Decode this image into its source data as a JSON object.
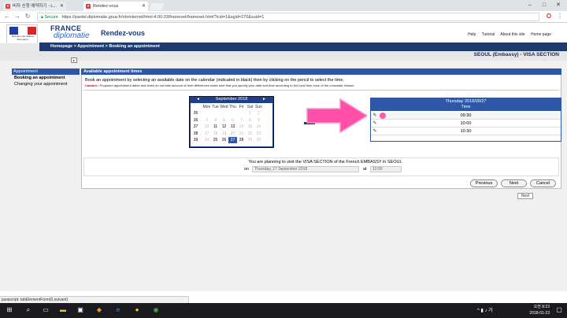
{
  "browser": {
    "tabs": [
      {
        "label": "비자 신청 예약하기 - L..."
      },
      {
        "label": "Rendez-vous"
      }
    ],
    "secure_label": "Secure",
    "url": "https://pastel.diplomatie.gouv.fr/rdvinternet/html-4.00.03/frameset/frameset.html?lcid=1&sgid=270&suid=1",
    "window_controls": [
      "–",
      "□",
      "✕"
    ]
  },
  "site": {
    "logo_text": "Ministère des Affaires Étrangères",
    "brand_line1": "FRANCE",
    "brand_line2": "diplomatie",
    "app_title": "Rendez-vous",
    "top_links": [
      "Help",
      "Tutorial",
      "About this site",
      "Home page"
    ],
    "breadcrumb": "Homepage > Appointment > Booking an appointment",
    "section_title": "SEOUL (Embassy) - VISA SECTION",
    "homepage_small": "Homepage"
  },
  "left_nav": {
    "header": "Appointment",
    "items": [
      {
        "label": "Booking an appointment"
      },
      {
        "label": "Changing your appointment"
      }
    ]
  },
  "panel": {
    "title": "Available appointment times",
    "instruction": "Book an appointment by selecting an available date on the calendar (indicated in black) then by clicking on the pencil to select the time.",
    "caution_label": "Caution :",
    "caution_text": "Proposed appointment dates and times do not take account of time differences make sure that you specify your date and time according to the local time zone of the consulate chosen."
  },
  "calendar": {
    "title": "September 2018",
    "prev": "◄",
    "next": "►",
    "day_headers": [
      "Mon",
      "Tue",
      "Wed",
      "Thu",
      "Fri",
      "Sat",
      "Sun"
    ],
    "weeks": [
      {
        "num": "35",
        "days": [
          "",
          "",
          "",
          "",
          "",
          "1",
          "2"
        ]
      },
      {
        "num": "36",
        "days": [
          "3",
          "4",
          "5",
          "6",
          "7",
          "8",
          "9"
        ]
      },
      {
        "num": "37",
        "days": [
          "10",
          "11",
          "12",
          "13",
          "14",
          "15",
          "16"
        ]
      },
      {
        "num": "38",
        "days": [
          "17",
          "18",
          "19",
          "20",
          "21",
          "22",
          "23"
        ]
      },
      {
        "num": "39",
        "days": [
          "24",
          "25",
          "26",
          "27",
          "28",
          "29",
          "30"
        ]
      }
    ],
    "selected": "27"
  },
  "slots": {
    "header": "Thursday 2018/09/27",
    "subheader": "Time",
    "times": [
      "09:30",
      "10:00",
      "10:30"
    ]
  },
  "plan": {
    "text": "You are planning to visit the VISA SECTION of the French EMBASSY in SEOUL",
    "on_label": "on",
    "date_value": "Thursday, 27 September 2018",
    "at_label": "at",
    "time_value": "10:00"
  },
  "buttons": {
    "previous": "Previous",
    "next": "Next",
    "cancel": "Cancel",
    "tooltip": "Next"
  },
  "status_bar": "javascript: tabElementForm(0,suivant)",
  "taskbar": {
    "time": "오전 8:23",
    "date": "2018-01-23"
  },
  "colors": {
    "brand_blue": "#1f3b6e",
    "accent_blue": "#2f57a8",
    "arrow_pink": "#ff4fa8"
  }
}
